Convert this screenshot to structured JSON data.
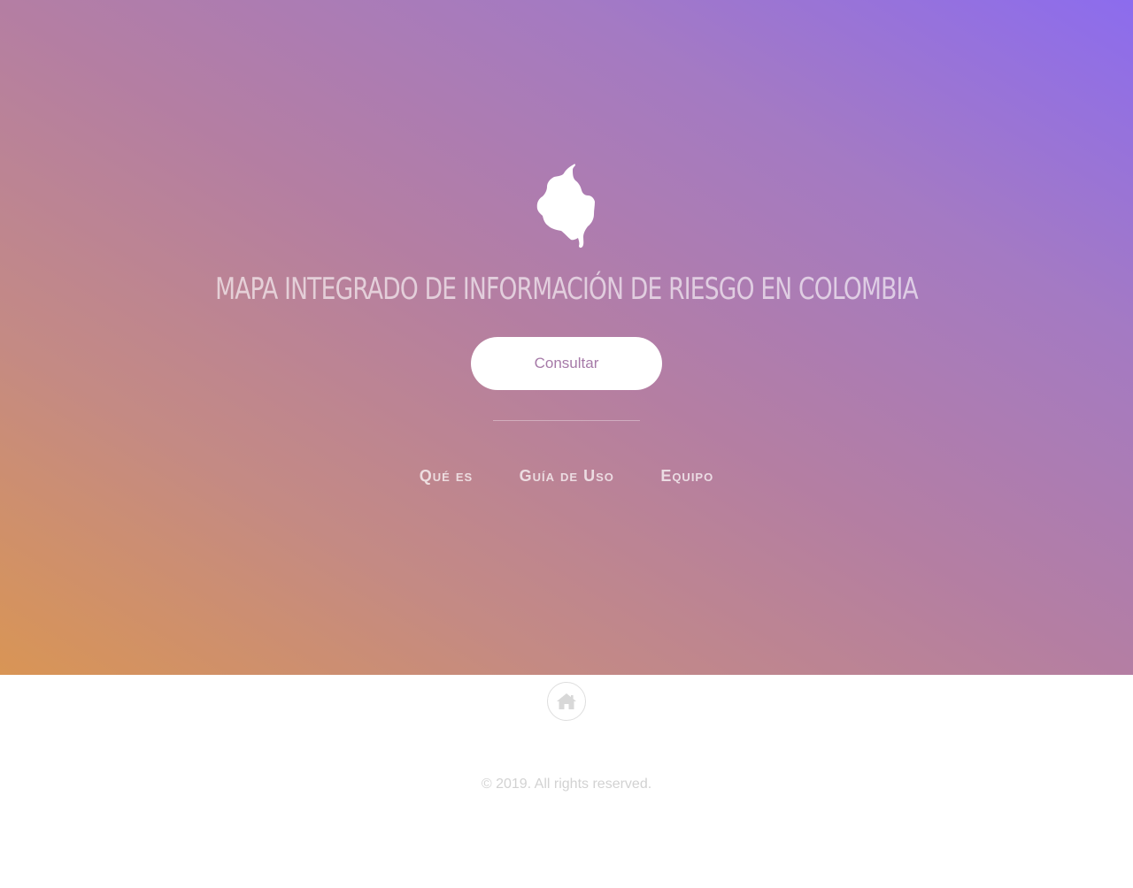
{
  "hero": {
    "logo_icon": "colombia-map-icon",
    "title": "MAPA INTEGRADO DE INFORMACIÓN DE RIESGO EN COLOMBIA",
    "cta_label": "Consultar",
    "gradient_colors": [
      "#d99555",
      "#b47ea3",
      "#8c6cee"
    ]
  },
  "nav": {
    "items": [
      {
        "label": "Qué es"
      },
      {
        "label": "Guía de Uso"
      },
      {
        "label": "Equipo"
      }
    ]
  },
  "footer": {
    "home_icon": "home-icon",
    "copyright": "© 2019. All rights reserved."
  }
}
